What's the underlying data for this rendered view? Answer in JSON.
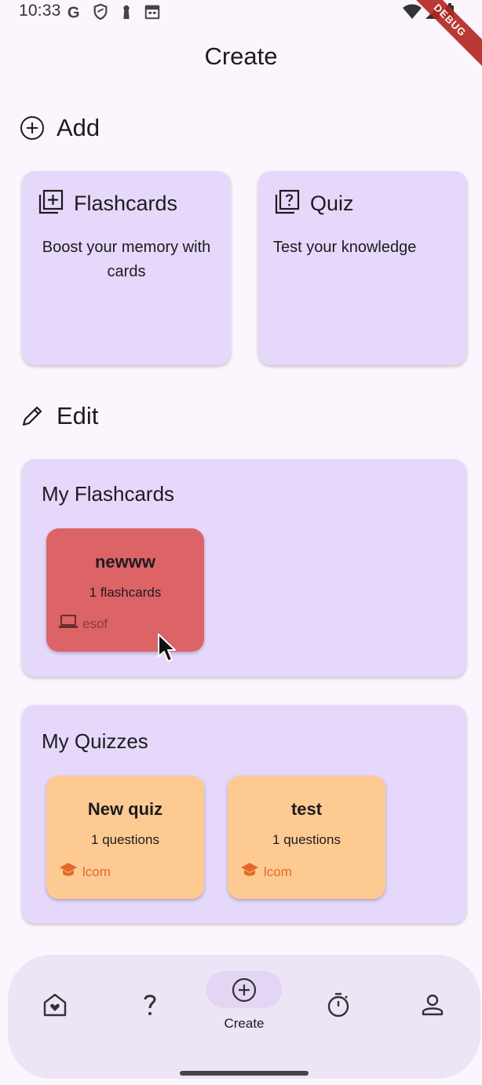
{
  "status_bar": {
    "time": "10:33",
    "left_icons": [
      "google-icon",
      "shield-icon",
      "keyhole-icon",
      "calendar-icon"
    ],
    "right_icons": [
      "wifi-icon",
      "signal-icon",
      "battery-icon"
    ],
    "debug_banner": "DEBUG"
  },
  "page": {
    "title": "Create"
  },
  "add_section": {
    "label": "Add",
    "icon": "add-circle-icon",
    "cards": [
      {
        "title": "Flashcards",
        "description": "Boost your memory with cards",
        "icon": "library-add-icon"
      },
      {
        "title": "Quiz",
        "description": "Test your knowledge",
        "icon": "quiz-icon"
      }
    ]
  },
  "edit_section": {
    "label": "Edit",
    "icon": "pencil-icon",
    "flashcards_group": {
      "title": "My Flashcards",
      "items": [
        {
          "name": "newww",
          "count": "1 flashcards",
          "tag": "esof",
          "tag_icon": "laptop-icon",
          "color": "#dc6467"
        }
      ]
    },
    "quizzes_group": {
      "title": "My Quizzes",
      "items": [
        {
          "name": "New quiz",
          "count": "1 questions",
          "tag": "lcom",
          "tag_icon": "school-icon",
          "color": "#fdcb92"
        },
        {
          "name": "test",
          "count": "1 questions",
          "tag": "lcom",
          "tag_icon": "school-icon",
          "color": "#fdcb92"
        }
      ]
    }
  },
  "bottom_nav": {
    "items": [
      {
        "icon": "home-heart-icon",
        "label": ""
      },
      {
        "icon": "question-mark-icon",
        "label": ""
      },
      {
        "icon": "add-circle-icon",
        "label": "Create",
        "selected": true
      },
      {
        "icon": "timer-icon",
        "label": ""
      },
      {
        "icon": "person-icon",
        "label": ""
      }
    ]
  },
  "colors": {
    "background": "#fbf6fd",
    "card": "#e6d8fb",
    "flashcard_tile": "#dc6467",
    "quiz_tile": "#fdcb92",
    "quiz_tag": "#e4682a",
    "nav_bar": "#ede4f5",
    "nav_pill": "#e3d6f5"
  }
}
